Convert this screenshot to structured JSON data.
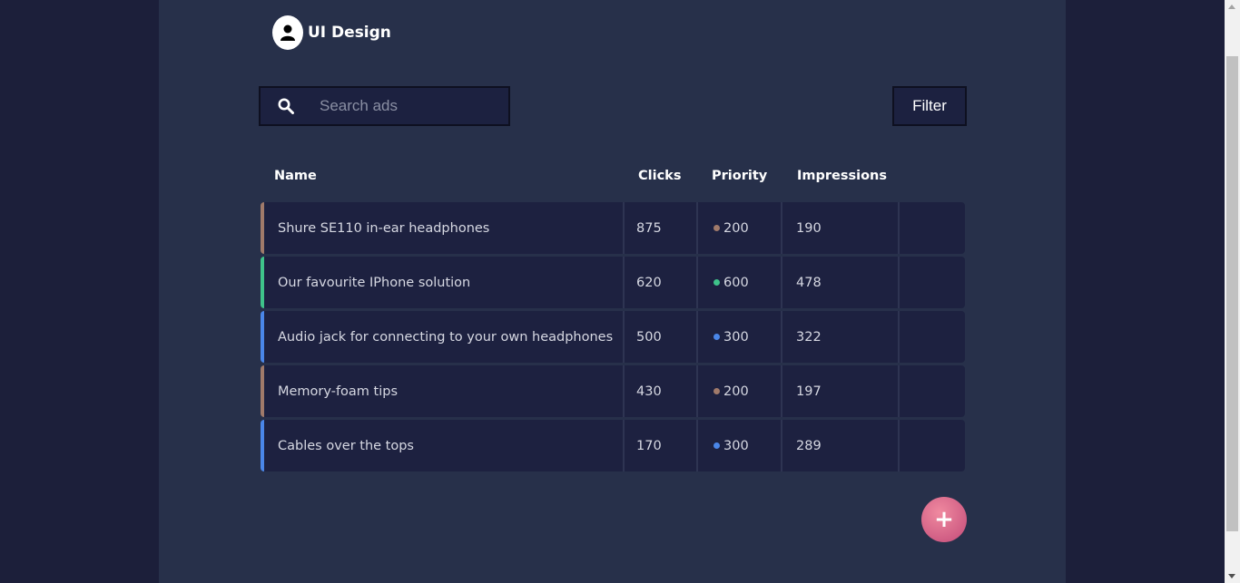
{
  "header": {
    "brand_title": "UI Design",
    "avatar_icon": "user-icon"
  },
  "search": {
    "placeholder": "Search ads",
    "value": "",
    "icon": "search-icon"
  },
  "toolbar": {
    "filter_label": "Filter",
    "add_label": "+"
  },
  "table": {
    "columns": {
      "name": "Name",
      "clicks": "Clicks",
      "priority": "Priority",
      "impressions": "Impressions"
    },
    "rows": [
      {
        "name": "Shure SE110 in-ear headphones",
        "clicks": "875",
        "priority": "200",
        "impressions": "190",
        "accent": "#a07a6a",
        "dot": "#a07a6a"
      },
      {
        "name": "Our favourite IPhone solution",
        "clicks": "620",
        "priority": "600",
        "impressions": "478",
        "accent": "#3fc38a",
        "dot": "#3fc38a"
      },
      {
        "name": "Audio jack for connecting to your own headphones",
        "clicks": "500",
        "priority": "300",
        "impressions": "322",
        "accent": "#4a86e8",
        "dot": "#4a86e8"
      },
      {
        "name": "Memory-foam tips",
        "clicks": "430",
        "priority": "200",
        "impressions": "197",
        "accent": "#a07a6a",
        "dot": "#a07a6a"
      },
      {
        "name": "Cables over the tops",
        "clicks": "170",
        "priority": "300",
        "impressions": "289",
        "accent": "#4a86e8",
        "dot": "#4a86e8"
      }
    ]
  },
  "colors": {
    "background": "#1c1f3a",
    "page": "#27304a",
    "row": "#1d2140",
    "add_button": "#d9607f"
  }
}
